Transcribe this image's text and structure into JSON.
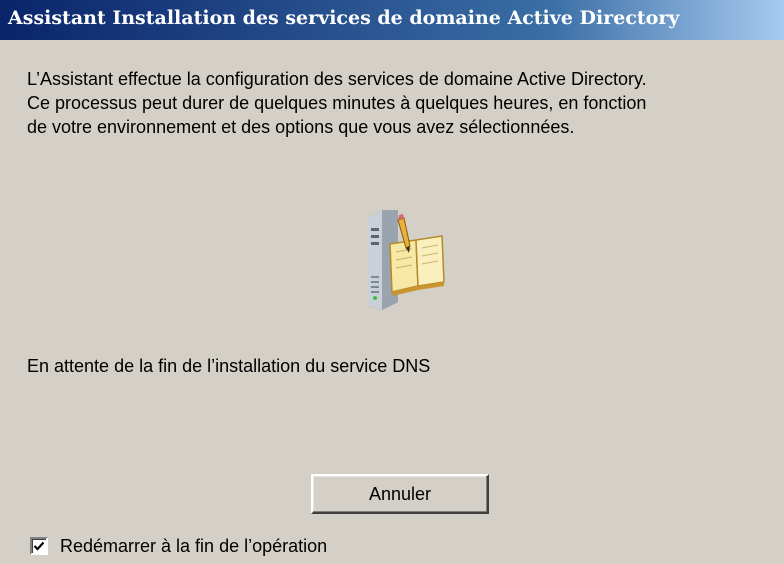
{
  "window": {
    "title": "Assistant Installation des services de domaine Active Directory"
  },
  "content": {
    "description_lines": [
      "L’Assistant effectue la configuration des services de domaine Active Directory.",
      "Ce processus peut durer de quelques minutes à quelques heures, en fonction",
      "de votre environnement et des options que vous avez sélectionnées."
    ],
    "icon": "server-book-icon",
    "status": "En attente de la fin de l’installation du service DNS"
  },
  "actions": {
    "cancel_label": "Annuler"
  },
  "options": {
    "restart_label": "Redémarrer à la fin de l’opération",
    "restart_checked": true
  },
  "colors": {
    "dialog_background": "#d4d0c8",
    "titlebar_start": "#0a246a",
    "titlebar_end": "#a6caf0",
    "title_text": "#ffffff"
  }
}
